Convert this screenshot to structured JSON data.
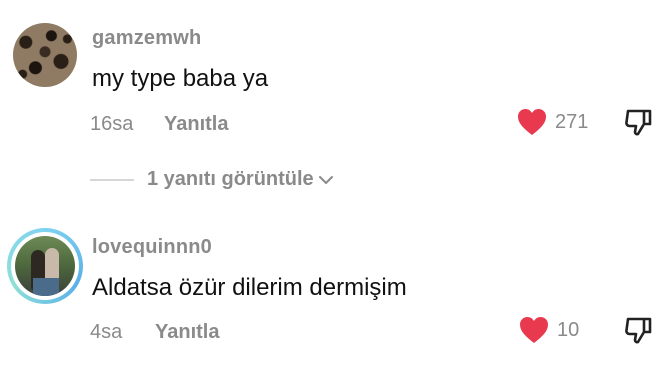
{
  "comments": [
    {
      "username": "gamzemwh",
      "text": "my type baba ya",
      "time": "16sa",
      "reply_label": "Yanıtla",
      "like_count": "271",
      "avatar": "leopard-print-avatar"
    },
    {
      "username": "lovequinnn0",
      "text": "Aldatsa özür dilerim dermişim",
      "time": "4sa",
      "reply_label": "Yanıtla",
      "like_count": "10",
      "avatar": "photo-avatar"
    }
  ],
  "view_replies": {
    "label": "1 yanıtı görüntüle"
  },
  "icons": {
    "like": "heart-icon",
    "dislike": "thumbs-down-icon",
    "expand": "chevron-down-icon"
  },
  "colors": {
    "like_red": "#e8394f",
    "muted_text": "#8a8a8a",
    "text": "#111111",
    "ring": "#7fd3f0"
  }
}
